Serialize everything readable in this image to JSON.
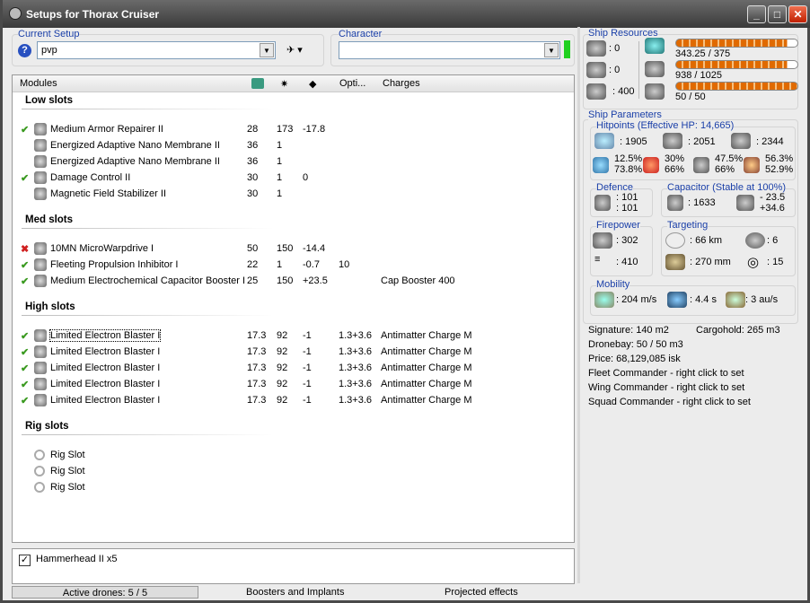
{
  "window": {
    "title": "Setups for Thorax Cruiser"
  },
  "setup": {
    "label": "Current Setup",
    "value": "pvp",
    "help": "?",
    "char_label": "Character",
    "char_value": ""
  },
  "list": {
    "headers": [
      "Modules",
      "Opti...",
      "Charges"
    ],
    "sections": [
      {
        "title": "Low slots",
        "rows": [
          {
            "state": "on",
            "name": "Medium Armor Repairer II",
            "c1": "28",
            "c2": "173",
            "c3": "-17.8",
            "opt": "",
            "charge": ""
          },
          {
            "state": "",
            "name": "Energized Adaptive Nano Membrane II",
            "c1": "36",
            "c2": "1",
            "c3": "",
            "opt": "",
            "charge": ""
          },
          {
            "state": "",
            "name": "Energized Adaptive Nano Membrane II",
            "c1": "36",
            "c2": "1",
            "c3": "",
            "opt": "",
            "charge": ""
          },
          {
            "state": "on",
            "name": "Damage Control II",
            "c1": "30",
            "c2": "1",
            "c3": "0",
            "opt": "",
            "charge": ""
          },
          {
            "state": "",
            "name": "Magnetic Field Stabilizer II",
            "c1": "30",
            "c2": "1",
            "c3": "",
            "opt": "",
            "charge": ""
          }
        ]
      },
      {
        "title": "Med slots",
        "rows": [
          {
            "state": "off",
            "name": "10MN MicroWarpdrive I",
            "c1": "50",
            "c2": "150",
            "c3": "-14.4",
            "opt": "",
            "charge": ""
          },
          {
            "state": "on",
            "name": "Fleeting Propulsion Inhibitor I",
            "c1": "22",
            "c2": "1",
            "c3": "-0.7",
            "opt": "10",
            "charge": ""
          },
          {
            "state": "on",
            "name": "Medium Electrochemical Capacitor Booster I",
            "c1": "25",
            "c2": "150",
            "c3": "+23.5",
            "opt": "",
            "charge": "Cap Booster 400"
          }
        ]
      },
      {
        "title": "High slots",
        "rows": [
          {
            "state": "on",
            "name": "Limited Electron Blaster I",
            "c1": "17.3",
            "c2": "92",
            "c3": "-1",
            "opt": "1.3+3.6",
            "charge": "Antimatter Charge M"
          },
          {
            "state": "on",
            "name": "Limited Electron Blaster I",
            "c1": "17.3",
            "c2": "92",
            "c3": "-1",
            "opt": "1.3+3.6",
            "charge": "Antimatter Charge M"
          },
          {
            "state": "on",
            "name": "Limited Electron Blaster I",
            "c1": "17.3",
            "c2": "92",
            "c3": "-1",
            "opt": "1.3+3.6",
            "charge": "Antimatter Charge M"
          },
          {
            "state": "on",
            "name": "Limited Electron Blaster I",
            "c1": "17.3",
            "c2": "92",
            "c3": "-1",
            "opt": "1.3+3.6",
            "charge": "Antimatter Charge M"
          },
          {
            "state": "on",
            "name": "Limited Electron Blaster I",
            "c1": "17.3",
            "c2": "92",
            "c3": "-1",
            "opt": "1.3+3.6",
            "charge": "Antimatter Charge M"
          }
        ]
      },
      {
        "title": "Rig slots",
        "rows": [
          {
            "state": "rig",
            "name": "Rig Slot",
            "c1": "",
            "c2": "",
            "c3": "",
            "opt": "",
            "charge": ""
          },
          {
            "state": "rig",
            "name": "Rig Slot",
            "c1": "",
            "c2": "",
            "c3": "",
            "opt": "",
            "charge": ""
          },
          {
            "state": "rig",
            "name": "Rig Slot",
            "c1": "",
            "c2": "",
            "c3": "",
            "opt": "",
            "charge": ""
          }
        ]
      }
    ]
  },
  "drones": {
    "item": "Hammerhead II x5",
    "checked": true
  },
  "status": {
    "active": "Active drones: 5 / 5",
    "boosters": "Boosters and Implants",
    "projected": "Projected effects"
  },
  "resources": {
    "title": "Ship Resources",
    "turrets": ": 0",
    "launchers": ": 0",
    "calibration": ": 400",
    "cpu": "343.25 / 375",
    "power": "938 / 1025",
    "drone_bw": "50 / 50",
    "cpu_pct": 91.5,
    "power_pct": 91.5,
    "drone_pct": 100
  },
  "params": {
    "title": "Ship Parameters",
    "hp_title": "Hitpoints (Effective HP: 14,665)",
    "shield": ": 1905",
    "armor": ": 2051",
    "hull": ": 2344",
    "res": [
      [
        "12.5%",
        "73.8%"
      ],
      [
        "30%",
        "66%"
      ],
      [
        "47.5%",
        "66%"
      ],
      [
        "56.3%",
        "52.9%"
      ]
    ],
    "defence_title": "Defence",
    "def1": ": 101",
    "def2": ": 101",
    "cap_title": "Capacitor (Stable at 100%)",
    "cap": ": 1633",
    "cap_use": "- 23.5",
    "cap_gain": "+34.6",
    "fp_title": "Firepower",
    "dps": ": 302",
    "volley": ": 410",
    "tg_title": "Targeting",
    "range": ": 66 km",
    "targets": ": 6",
    "scanres": ": 270 mm",
    "sensor": ": 15",
    "mob_title": "Mobility",
    "speed": ": 204 m/s",
    "align": ": 4.4 s",
    "warp": ": 3 au/s"
  },
  "info": {
    "signature": "Signature: 140 m2",
    "cargo": "Cargohold: 265 m3",
    "dronebay": "Dronebay: 50 / 50 m3",
    "price": "Price: 68,129,085 isk",
    "fleet": "Fleet Commander - right click to set",
    "wing": "Wing Commander - right click to set",
    "squad": "Squad Commander - right click to set"
  }
}
